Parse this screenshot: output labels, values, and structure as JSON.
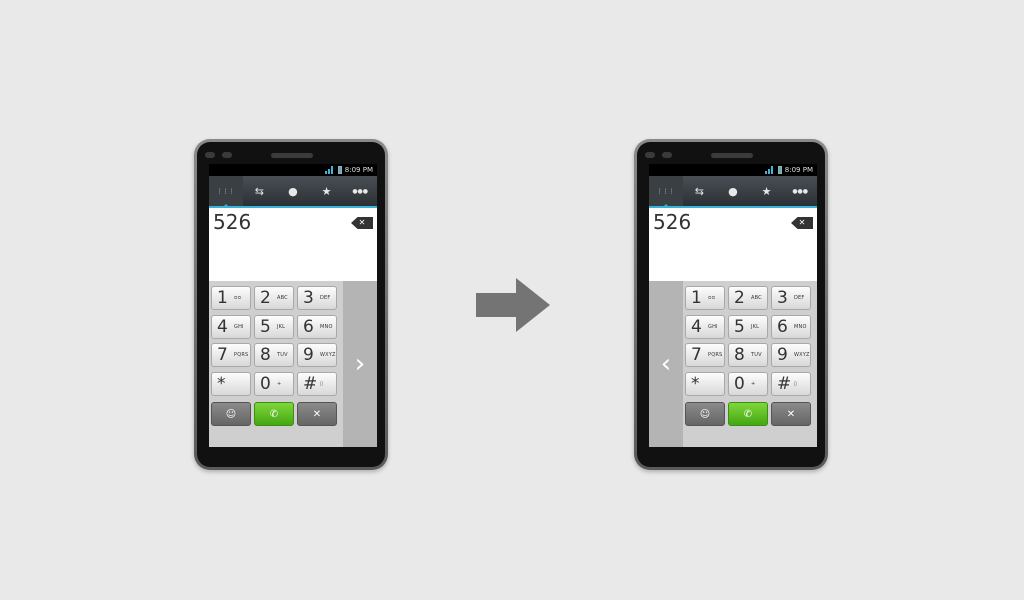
{
  "phones": [
    {
      "status_time": "8:09 PM",
      "dialed_number": "526",
      "side_chevron": "›",
      "side": "right"
    },
    {
      "status_time": "8:09 PM",
      "dialed_number": "526",
      "side_chevron": "‹",
      "side": "left"
    }
  ],
  "tabs": [
    {
      "icon": "dialpad-icon",
      "glyph": "⋮⋮⋮"
    },
    {
      "icon": "call-log-icon",
      "glyph": "⇆"
    },
    {
      "icon": "contacts-icon",
      "glyph": "●"
    },
    {
      "icon": "favorites-icon",
      "glyph": "★"
    },
    {
      "icon": "groups-icon",
      "glyph": "●●●"
    }
  ],
  "keys": [
    {
      "digit": "1",
      "letters": "ᴑᴑ"
    },
    {
      "digit": "2",
      "letters": "ABC"
    },
    {
      "digit": "3",
      "letters": "DEF"
    },
    {
      "digit": "4",
      "letters": "GHI"
    },
    {
      "digit": "5",
      "letters": "JKL"
    },
    {
      "digit": "6",
      "letters": "MNO"
    },
    {
      "digit": "7",
      "letters": "PQRS"
    },
    {
      "digit": "8",
      "letters": "TUV"
    },
    {
      "digit": "9",
      "letters": "WXYZ"
    },
    {
      "digit": "*",
      "letters": ""
    },
    {
      "digit": "0",
      "letters": "+"
    },
    {
      "digit": "#",
      "letters": "▯"
    }
  ],
  "function_keys": {
    "message_glyph": "☺",
    "call_glyph": "✆",
    "backspace_glyph": "✕"
  },
  "colors": {
    "accent": "#35b3d9",
    "call_green": "#44a714",
    "arrow": "#747474"
  }
}
